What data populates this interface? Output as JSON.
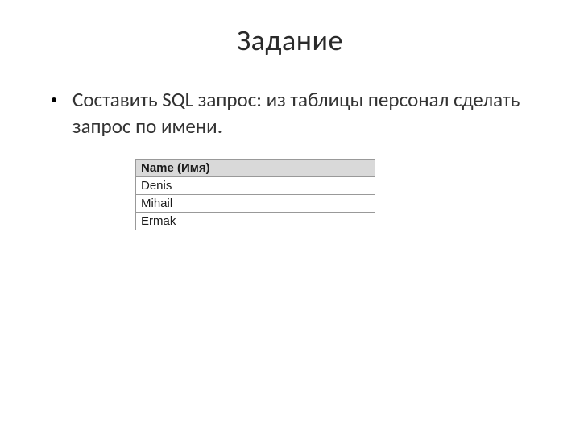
{
  "title": "Задание",
  "bullet": "Составить SQL запрос: из таблицы персонал сделать запрос по имени.",
  "table": {
    "header": "Name (Имя)",
    "rows": [
      "Denis",
      "Mihail",
      "Ermak"
    ]
  }
}
